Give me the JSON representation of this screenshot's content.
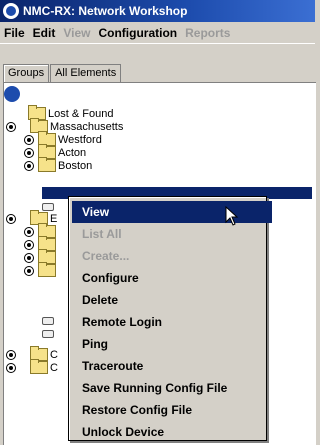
{
  "title": "NMC-RX: Network Workshop",
  "menu": [
    "File",
    "Edit",
    "View",
    "Configuration",
    "Reports"
  ],
  "tabs": [
    "Groups",
    "All Elements"
  ],
  "tree": {
    "lost_found": "Lost & Found",
    "massachusetts": "Massachusetts",
    "westford": "Westford",
    "acton": "Acton",
    "boston": "Boston",
    "e": "E",
    "c1": "C",
    "c2": "C"
  },
  "context_menu": [
    "View",
    "List All",
    "Create...",
    "Configure",
    "Delete",
    "Remote Login",
    "Ping",
    "Traceroute",
    "Save Running Config File",
    "Restore Config File",
    "Unlock Device"
  ]
}
